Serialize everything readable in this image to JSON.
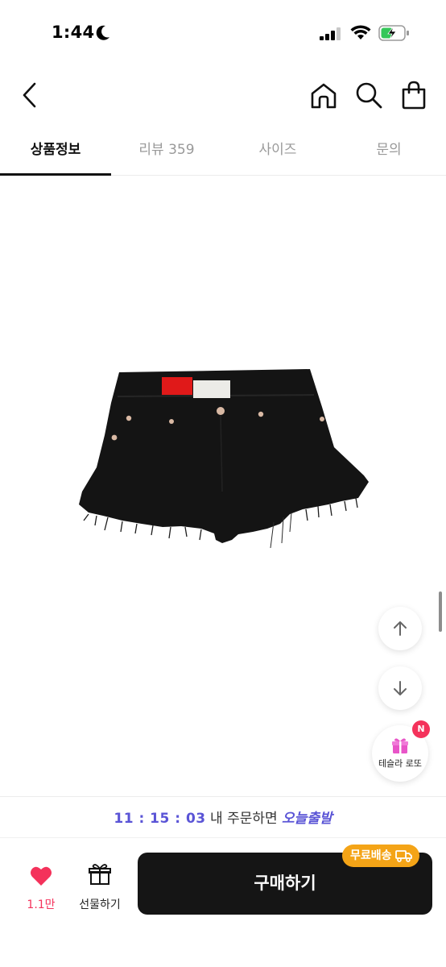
{
  "status_bar": {
    "time": "1:44"
  },
  "tabs": [
    {
      "label": "상품정보",
      "active": true
    },
    {
      "label": "리뷰 359",
      "active": false
    },
    {
      "label": "사이즈",
      "active": false
    },
    {
      "label": "문의",
      "active": false
    }
  ],
  "floating": {
    "lotto_label": "테슬라 로또",
    "lotto_badge": "N"
  },
  "delivery": {
    "countdown": "11 : 15 : 03",
    "text": " 내 주문하면 ",
    "highlight": "오늘출발"
  },
  "bottom_bar": {
    "like_count": "1.1만",
    "gift_label": "선물하기",
    "buy_label": "구매하기",
    "free_shipping_label": "무료배송"
  },
  "colors": {
    "accent_purple": "#5a54d6",
    "like_red": "#f4325b",
    "badge_orange": "#f4a417",
    "buy_button": "#151515"
  }
}
